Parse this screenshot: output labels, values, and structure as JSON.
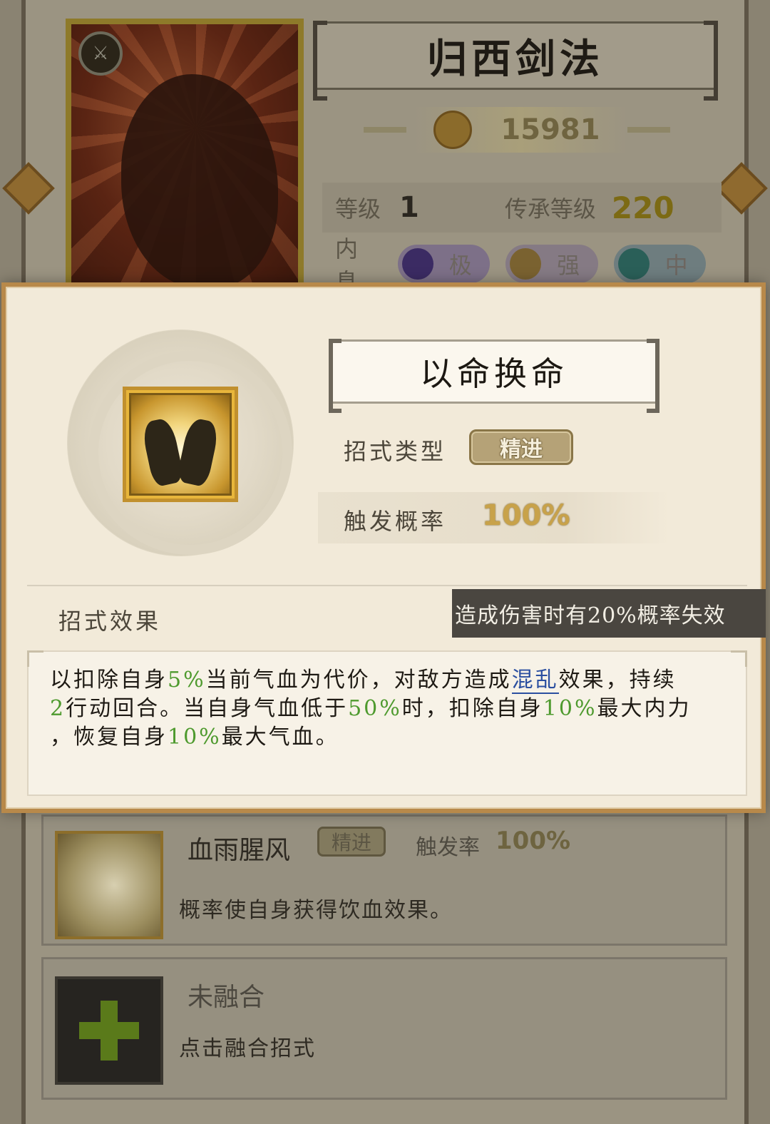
{
  "background": {
    "skill_title": "归西剑法",
    "power": "15981",
    "level": {
      "label": "等级",
      "value": "1",
      "inherit_label": "传承等级",
      "inherit_value": "220"
    },
    "neixi": {
      "label": "内息",
      "pills": [
        "极",
        "强",
        "中"
      ]
    },
    "list": [
      {
        "title": "血雨腥风",
        "tag": "精进",
        "rate_label": "触发率",
        "rate": "100%",
        "desc": "概率使自身获得饮血效果。"
      },
      {
        "title": "未融合",
        "desc": "点击融合招式"
      }
    ]
  },
  "popup": {
    "move_name": "以命换命",
    "type_label": "招式类型",
    "type_tag": "精进",
    "trigger_label": "触发概率",
    "trigger_value": "100%",
    "effect_label": "招式效果",
    "tooltip": "造成伤害时有20%概率失效",
    "desc": {
      "l1a": "以扣除自身",
      "l1b": "5%",
      "l1c": "当前气血为代价，对敌方造成",
      "l1d": "混乱",
      "l1e": "效果，持续",
      "l2a": "2",
      "l2b": "行动回合。当自身气血低于",
      "l2c": "50%",
      "l2d": "时，扣除自身",
      "l2e": "10%",
      "l2f": "最大内力",
      "l3a": "，恢复自身",
      "l3b": "10%",
      "l3c": "最大气血。"
    }
  },
  "colors": {
    "highlight_green": "#4e9a2e",
    "highlight_blue": "#2b4fa0",
    "gold": "#c8a24a"
  },
  "icons": [
    "sword-badge-icon",
    "power-medal-icon",
    "moon-icon",
    "sun-icon",
    "jade-icon",
    "plus-icon"
  ]
}
